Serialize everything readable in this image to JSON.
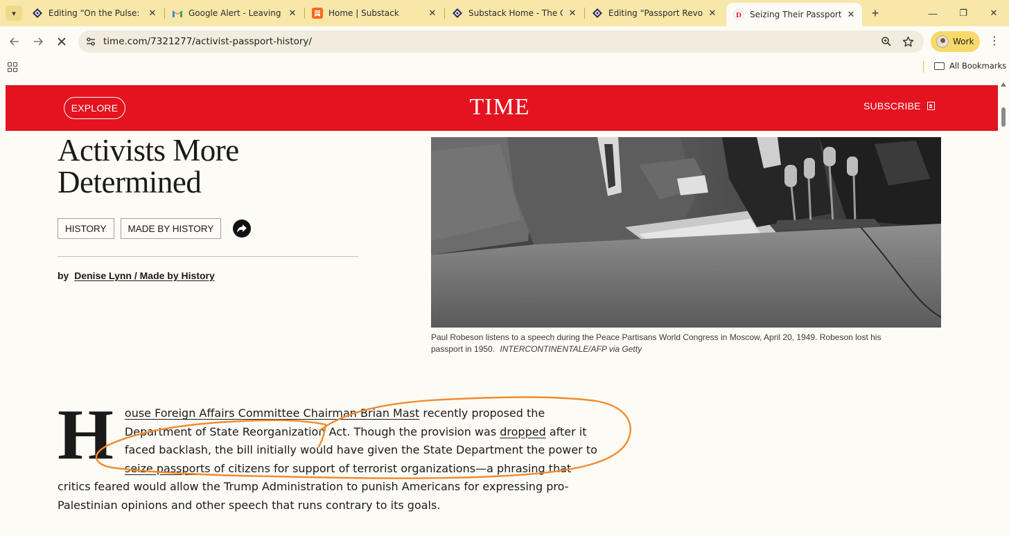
{
  "browser": {
    "tabs": [
      {
        "title": "Editing “On the Pulse: Wee",
        "favicon": "substack-editor-icon"
      },
      {
        "title": "Google Alert - Leaving the",
        "favicon": "gmail-icon"
      },
      {
        "title": "Home | Substack",
        "favicon": "substack-icon"
      },
      {
        "title": "Substack Home - The Cons",
        "favicon": "substack-editor-icon"
      },
      {
        "title": "Editing “Passport Revocatio",
        "favicon": "substack-editor-icon"
      },
      {
        "title": "Seizing Their Passports On",
        "favicon": "time-icon",
        "active": true
      }
    ],
    "url": "time.com/7321277/activist-passport-history/",
    "profile_label": "Work",
    "bookmarks_label": "All Bookmarks"
  },
  "site": {
    "explore_label": "EXPLORE",
    "logo": "TIME",
    "subscribe_label": "SUBSCRIBE",
    "brand_color": "#e4131f"
  },
  "article": {
    "headline_line1": "Activists More",
    "headline_line2": "Determined",
    "tags": [
      "HISTORY",
      "MADE BY HISTORY"
    ],
    "byline_prefix": "by",
    "byline_author": "Denise Lynn / Made by History",
    "caption_text": "Paul Robeson listens to a speech during the Peace Partisans World Congress in Moscow, April 20, 1949. Robeson lost his passport in 1950.",
    "caption_credit": "INTERCONTINENTALE/AFP via Getty",
    "dropcap": "H",
    "p1_link1": "ouse Foreign Affairs Committee Chairman Brian Mast",
    "p1_text1": " recently proposed the Department of State Reorganization Act. Though the provision was ",
    "p1_link2": "dropped",
    "p1_text2": " after it faced backlash, the bill initially would have given the State Department the power to ",
    "p1_link3": "seize passports",
    "p1_text3": " of citizens for support of terrorist organizations—a phrasing that critics feared would allow the Trump Administration to punish Americans for expressing pro-Palestinian opinions and other speech that runs contrary to its goals."
  }
}
